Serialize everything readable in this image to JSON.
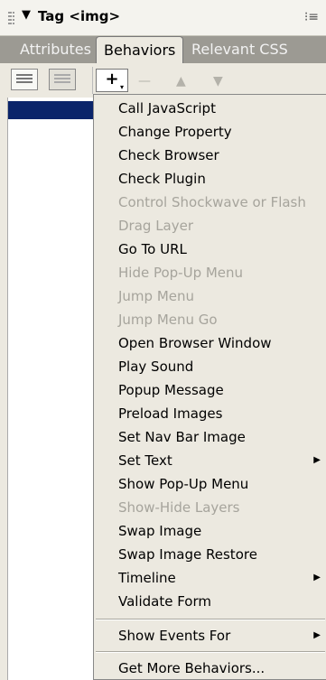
{
  "panel": {
    "title": "Tag <img>",
    "collapse_glyph": "▼",
    "options_glyph": "⁝≡"
  },
  "tabs": [
    {
      "label": "Attributes",
      "active": false
    },
    {
      "label": "Behaviors",
      "active": true
    },
    {
      "label": "Relevant CSS",
      "active": false
    }
  ],
  "toolbar": {
    "add_label": "+",
    "add_sub": "▾",
    "remove_label": "—",
    "up_label": "▲",
    "down_label": "▼"
  },
  "menu": {
    "items": [
      {
        "label": "Call JavaScript",
        "disabled": false
      },
      {
        "label": "Change Property",
        "disabled": false
      },
      {
        "label": "Check Browser",
        "disabled": false
      },
      {
        "label": "Check Plugin",
        "disabled": false
      },
      {
        "label": "Control Shockwave or Flash",
        "disabled": true
      },
      {
        "label": "Drag Layer",
        "disabled": true
      },
      {
        "label": "Go To URL",
        "disabled": false
      },
      {
        "label": "Hide Pop-Up Menu",
        "disabled": true
      },
      {
        "label": "Jump Menu",
        "disabled": true
      },
      {
        "label": "Jump Menu Go",
        "disabled": true
      },
      {
        "label": "Open Browser Window",
        "disabled": false
      },
      {
        "label": "Play Sound",
        "disabled": false
      },
      {
        "label": "Popup Message",
        "disabled": false
      },
      {
        "label": "Preload Images",
        "disabled": false
      },
      {
        "label": "Set Nav Bar Image",
        "disabled": false
      },
      {
        "label": "Set Text",
        "disabled": false,
        "submenu": true
      },
      {
        "label": "Show Pop-Up Menu",
        "disabled": false
      },
      {
        "label": "Show-Hide Layers",
        "disabled": true
      },
      {
        "label": "Swap Image",
        "disabled": false
      },
      {
        "label": "Swap Image Restore",
        "disabled": false
      },
      {
        "label": "Timeline",
        "disabled": false,
        "submenu": true
      },
      {
        "label": "Validate Form",
        "disabled": false
      }
    ],
    "show_events": {
      "label": "Show Events For",
      "submenu": true
    },
    "get_more": {
      "label": "Get More Behaviors..."
    },
    "submenu_glyph": "▶"
  }
}
